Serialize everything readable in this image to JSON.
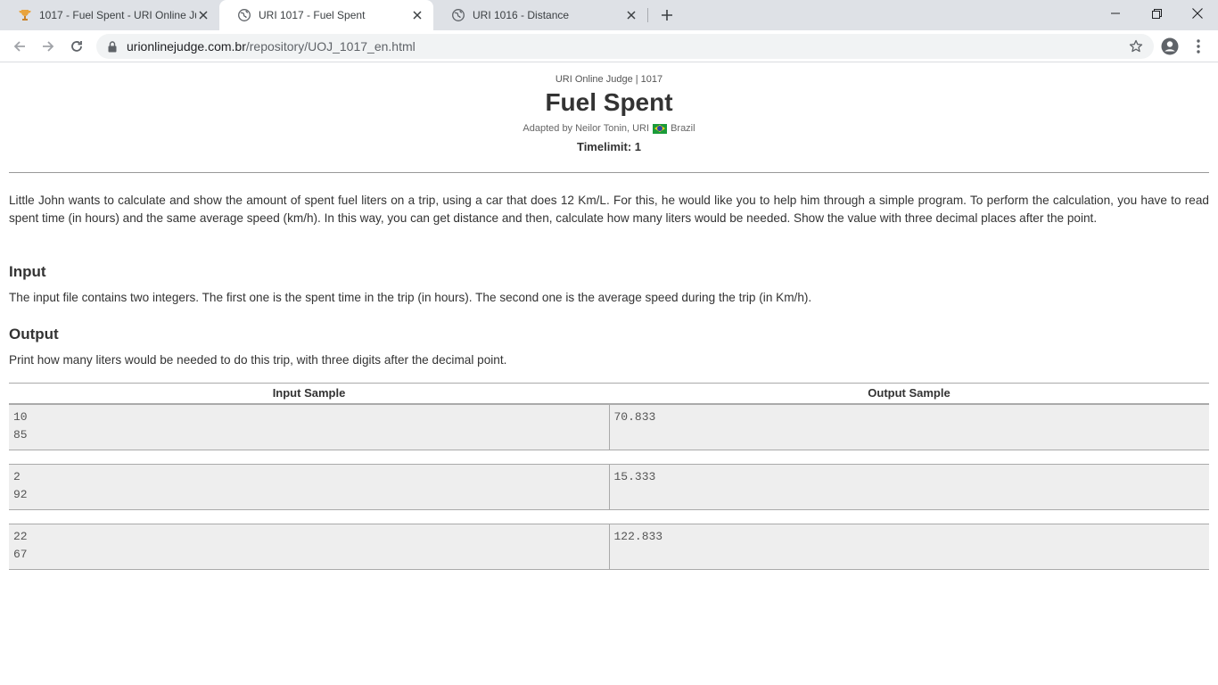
{
  "browser": {
    "tabs": [
      {
        "title": "1017 - Fuel Spent - URI Online Ju",
        "active": false,
        "icon": "trophy-icon"
      },
      {
        "title": "URI 1017 - Fuel Spent",
        "active": true,
        "icon": "globe-icon"
      },
      {
        "title": "URI 1016 - Distance",
        "active": false,
        "icon": "globe-icon"
      }
    ],
    "url": {
      "host": "urionlinejudge.com.br",
      "path": "/repository/UOJ_1017_en.html"
    }
  },
  "page": {
    "judge_line": "URI Online Judge | 1017",
    "title": "Fuel Spent",
    "adapted": "Adapted by Neilor Tonin, URI",
    "country": "Brazil",
    "timelimit": "Timelimit: 1",
    "description": "Little John wants to calculate and show the amount of spent fuel liters on a trip, using a car that does 12 Km/L. For this, he would like you to help him through a simple program. To perform the calculation, you have to read spent time (in hours) and the same average speed (km/h). In this way, you can get distance and then, calculate how many liters would be needed. Show the value with three decimal places after the point.",
    "input_heading": "Input",
    "input_text": "The input file contains two integers. The first one is the spent time in the trip (in hours). The second one is the average speed during the trip (in Km/h).",
    "output_heading": "Output",
    "output_text": "Print how many liters would be needed to do this trip, with three digits after the decimal point.",
    "samples": {
      "input_header": "Input Sample",
      "output_header": "Output Sample",
      "rows": [
        {
          "input": "10\n85",
          "output": "70.833"
        },
        {
          "input": "2\n92",
          "output": "15.333"
        },
        {
          "input": "22\n67",
          "output": "122.833"
        }
      ]
    }
  }
}
